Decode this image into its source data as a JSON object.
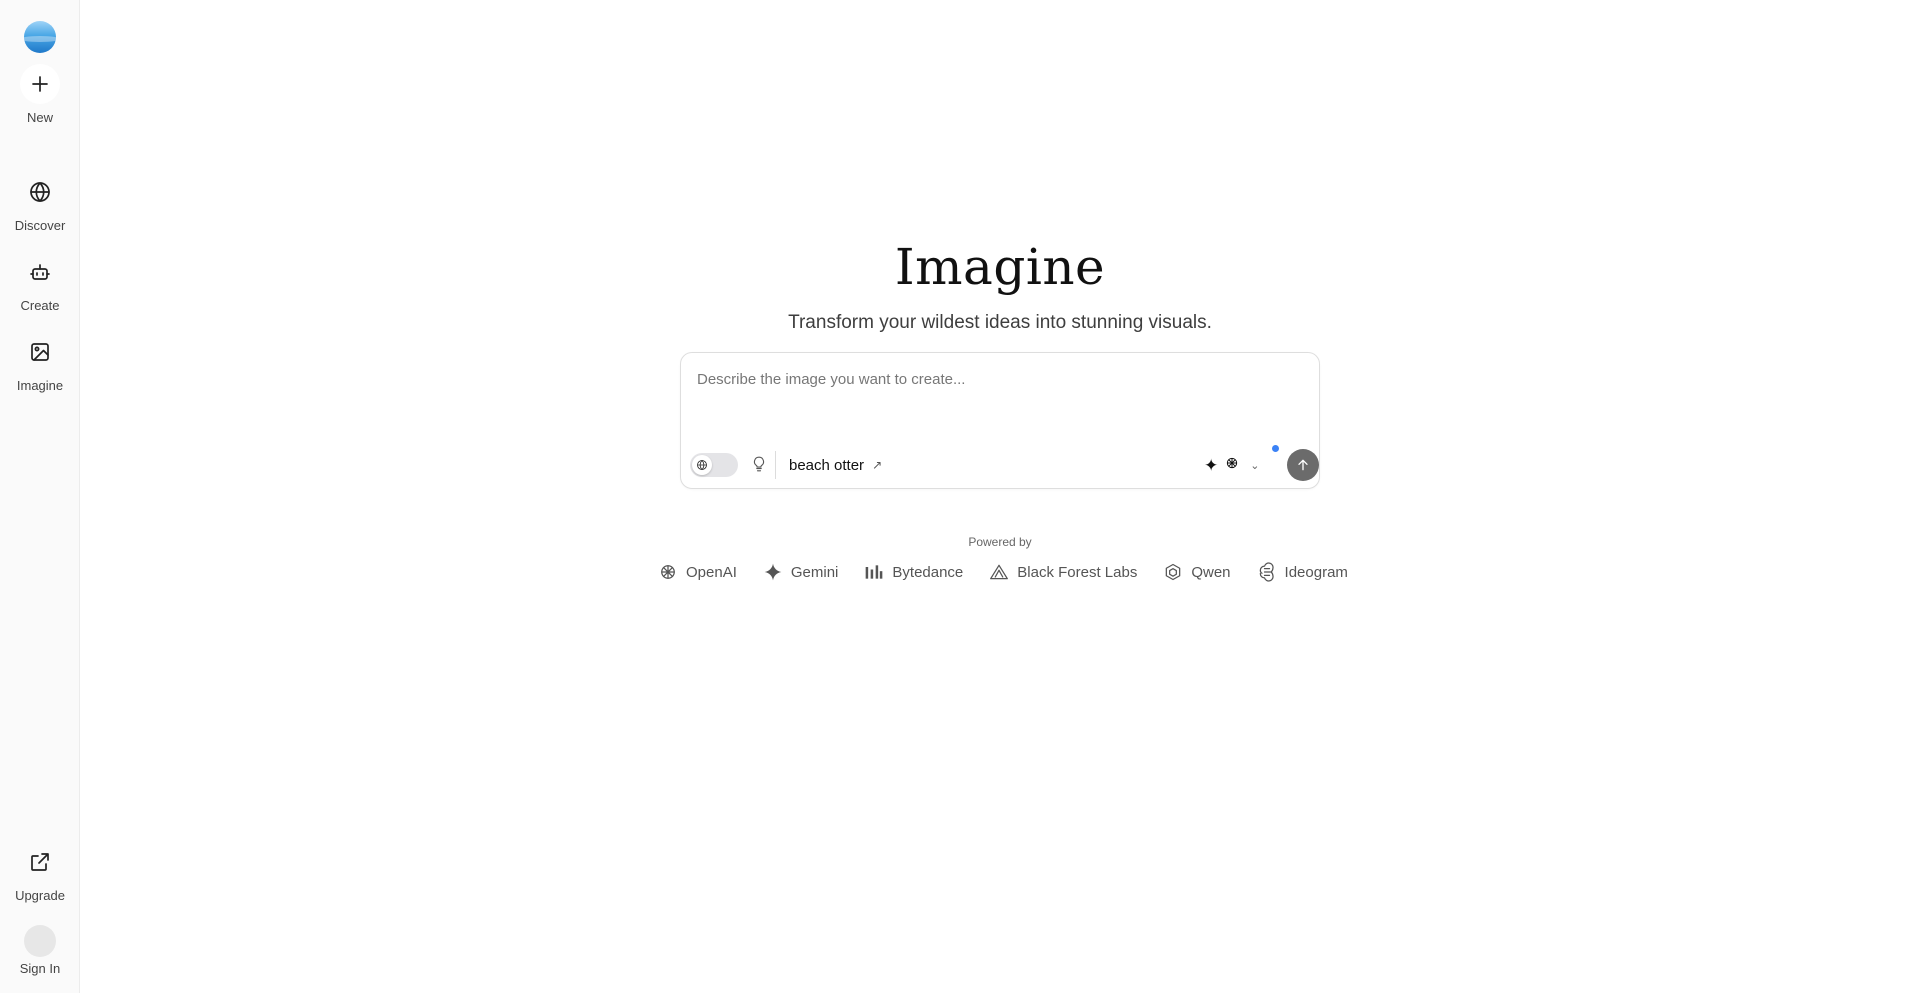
{
  "sidebar": {
    "items": [
      {
        "label": "New",
        "icon": "plus-icon"
      },
      {
        "label": "Discover",
        "icon": "globe-icon"
      },
      {
        "label": "Create",
        "icon": "robot-icon"
      },
      {
        "label": "Imagine",
        "icon": "image-icon"
      }
    ],
    "footer": [
      {
        "label": "Upgrade",
        "icon": "external-link-icon"
      },
      {
        "label": "Sign In",
        "icon": "avatar"
      }
    ]
  },
  "main": {
    "title": "Imagine",
    "subtitle": "Transform your wildest ideas into stunning visuals.",
    "prompt": {
      "placeholder": "Describe the image you want to create...",
      "value": "",
      "suggestion": "beach otter",
      "toggle_on": false
    },
    "powered_by": "Powered by",
    "providers": [
      "OpenAI",
      "Gemini",
      "Bytedance",
      "Black Forest Labs",
      "Qwen",
      "Ideogram"
    ]
  },
  "colors": {
    "accent_dot": "#3b82f6",
    "send_button": "#6b6b6b",
    "sidebar_bg": "#fafafa"
  }
}
